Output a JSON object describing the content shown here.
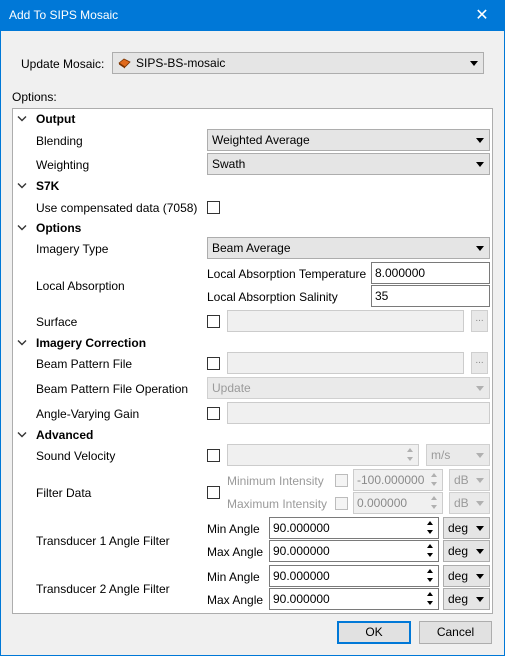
{
  "window": {
    "title": "Add To SIPS Mosaic",
    "close_glyph": "✕"
  },
  "update_mosaic": {
    "label": "Update Mosaic:",
    "value": "SIPS-BS-mosaic"
  },
  "options_label": "Options:",
  "sections": {
    "output": {
      "title": "Output",
      "blending": {
        "label": "Blending",
        "value": "Weighted Average"
      },
      "weighting": {
        "label": "Weighting",
        "value": "Swath"
      }
    },
    "s7k": {
      "title": "S7K",
      "use_compensated": {
        "label": "Use compensated data (7058)",
        "checked": false
      }
    },
    "options": {
      "title": "Options",
      "imagery_type": {
        "label": "Imagery Type",
        "value": "Beam Average"
      },
      "local_absorption": {
        "label": "Local Absorption",
        "temperature_label": "Local Absorption Temperature",
        "temperature_value": "8.000000",
        "salinity_label": "Local Absorption Salinity",
        "salinity_value": "35"
      },
      "surface": {
        "label": "Surface",
        "checked": false,
        "value": "",
        "browse": "..."
      }
    },
    "imagery_correction": {
      "title": "Imagery Correction",
      "beam_pattern_file": {
        "label": "Beam Pattern File",
        "checked": false,
        "value": "",
        "browse": "..."
      },
      "beam_pattern_op": {
        "label": "Beam Pattern File Operation",
        "value": "Update"
      },
      "angle_varying_gain": {
        "label": "Angle-Varying Gain",
        "checked": false,
        "value": ""
      }
    },
    "advanced": {
      "title": "Advanced",
      "sound_velocity": {
        "label": "Sound Velocity",
        "checked": false,
        "value": "",
        "unit": "m/s"
      },
      "filter_data": {
        "label": "Filter Data",
        "checked": false,
        "min_label": "Minimum Intensity",
        "min_value": "-100.000000",
        "min_unit": "dB",
        "max_label": "Maximum Intensity",
        "max_value": "0.000000",
        "max_unit": "dB"
      },
      "t1": {
        "label": "Transducer 1 Angle Filter",
        "min_label": "Min Angle",
        "min_value": "90.000000",
        "min_unit": "deg",
        "max_label": "Max Angle",
        "max_value": "90.000000",
        "max_unit": "deg"
      },
      "t2": {
        "label": "Transducer 2 Angle Filter",
        "min_label": "Min Angle",
        "min_value": "90.000000",
        "min_unit": "deg",
        "max_label": "Max Angle",
        "max_value": "90.000000",
        "max_unit": "deg"
      }
    }
  },
  "buttons": {
    "ok": "OK",
    "cancel": "Cancel"
  },
  "colors": {
    "titlebar": "#0078d7",
    "focus": "#0078d7",
    "background": "#f0f0f0"
  }
}
